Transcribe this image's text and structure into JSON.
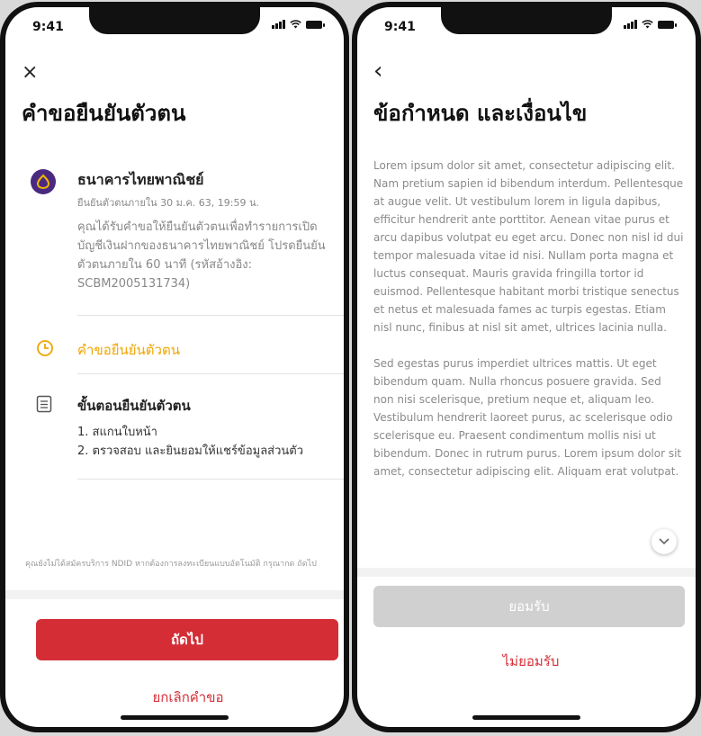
{
  "status": {
    "time": "9:41"
  },
  "left": {
    "close_icon": "×",
    "title": "คำขอยืนยันตัวตน",
    "bank": {
      "name": "ธนาคารไทยพาณิชย์",
      "deadline": "ยืนยันตัวตนภายใน 30 ม.ค. 63, 19:59 น.",
      "description": "คุณได้รับคำขอให้ยืนยันตัวตนเพื่อทำรายการเปิดบัญชีเงินฝากของธนาคารไทยพาณิชย์ โปรดยืนยันตัวตนภายใน 60 นาที (รหัสอ้างอิง: SCBM2005131734)"
    },
    "request_label": "คำขอยืนยันตัวตน",
    "steps_title": "ขั้นตอนยืนยันตัวตน",
    "steps": [
      "1. สแกนใบหน้า",
      "2. ตรวจสอบ และยินยอมให้แชร์ข้อมูลส่วนตัว"
    ],
    "footnote": "คุณยังไม่ได้สมัครบริการ NDID หากต้องการลงทะเบียนแบบอัตโนมัติ กรุณากด ถัดไป",
    "next_label": "ถัดไป",
    "cancel_label": "ยกเลิกคำขอ"
  },
  "right": {
    "back_icon": "‹",
    "title": "ข้อกำหนด และเงื่อนไข",
    "paragraphs": [
      "Lorem ipsum dolor sit amet, consectetur adipiscing elit. Nam pretium sapien id bibendum interdum. Pellentesque at augue velit. Ut vestibulum lorem in ligula dapibus, efficitur hendrerit ante porttitor. Aenean vitae purus et arcu dapibus volutpat eu eget arcu. Donec non nisl id dui tempor malesuada vitae id nisi. Nullam porta magna et luctus consequat. Mauris gravida fringilla tortor id euismod. Pellentesque habitant morbi tristique senectus et netus et malesuada fames ac turpis egestas. Etiam nisl nunc, finibus at nisl sit amet, ultrices lacinia nulla.",
      "Sed egestas purus imperdiet ultrices mattis. Ut eget bibendum quam. Nulla rhoncus posuere gravida. Sed non nisi scelerisque, pretium neque et, aliquam leo. Vestibulum hendrerit laoreet purus, ac scelerisque odio scelerisque eu. Praesent condimentum mollis nisi ut bibendum. Donec in rutrum purus. Lorem ipsum dolor sit amet, consectetur adipiscing elit. Aliquam erat volutpat."
    ],
    "accept_label": "ยอมรับ",
    "decline_label": "ไม่ยอมรับ"
  },
  "colors": {
    "primary_red": "#d42d36",
    "accent_orange": "#f0a500",
    "bank_purple": "#4a2a80",
    "disabled_gray": "#d0d0d0"
  },
  "icons": [
    "close-icon",
    "back-icon",
    "clock-icon",
    "document-icon",
    "chevron-down-icon",
    "bank-logo-icon"
  ]
}
